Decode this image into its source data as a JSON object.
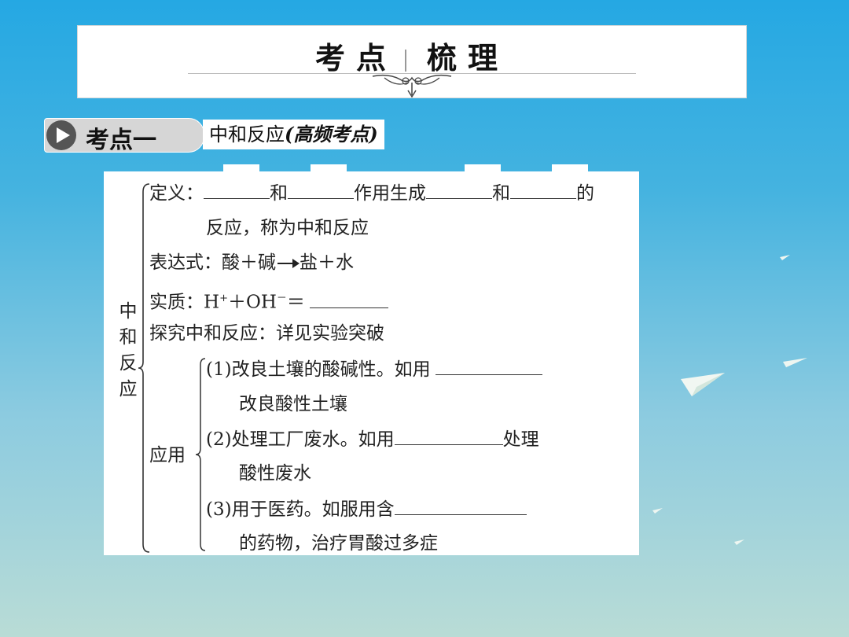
{
  "header": {
    "left": "考点",
    "right": "梳理"
  },
  "kaodian": {
    "label": "考点一",
    "topic": "中和反应",
    "tag": "(高频考点)"
  },
  "content": {
    "main_label": "中和反应",
    "def": {
      "a": "定义：",
      "b": "和",
      "c": "作用生成",
      "d": "和",
      "e": "的",
      "f": "反应，称为中和反应"
    },
    "expr": {
      "a": "表达式：酸＋碱",
      "b": "盐＋水"
    },
    "essence": {
      "a": "实质：H",
      "sup1": "+",
      "b": "＋OH",
      "sup2": "－",
      "c": "＝"
    },
    "explore": "探究中和反应：详见实验突破",
    "apply_label": "应用",
    "app1": {
      "a": "(1)改良土壤的酸碱性。如用",
      "b": "改良酸性土壤"
    },
    "app2": {
      "a": "(2)处理工厂废水。如用",
      "b": "处理",
      "c": "酸性废水"
    },
    "app3": {
      "a": "(3)用于医药。如服用含",
      "b": "的药物，治疗胃酸过多症"
    }
  }
}
